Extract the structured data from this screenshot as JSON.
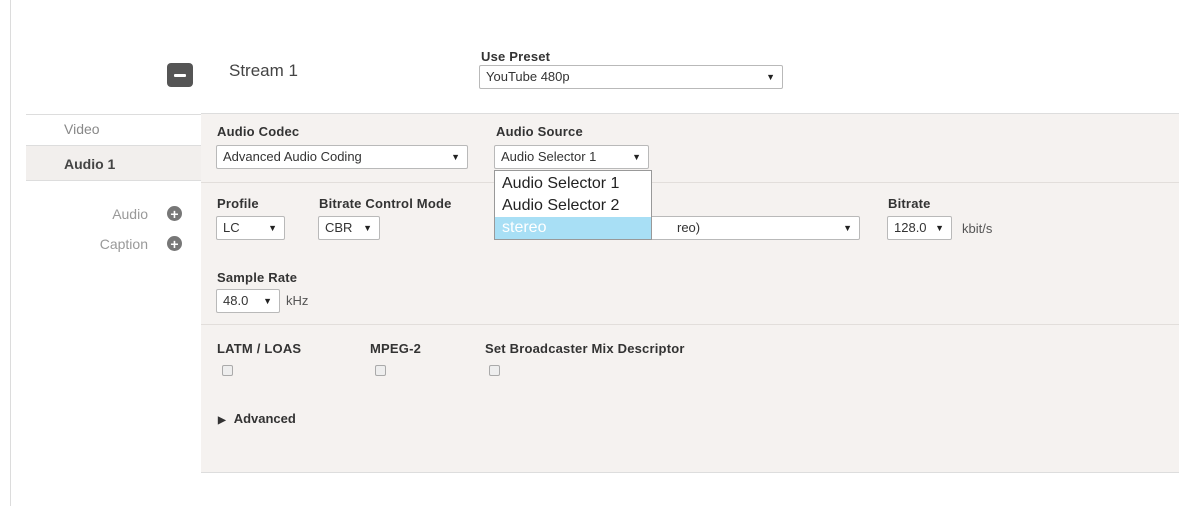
{
  "stream": {
    "title": "Stream 1",
    "preset_label": "Use Preset",
    "preset_value": "YouTube 480p"
  },
  "tabs": [
    {
      "label": "Video"
    },
    {
      "label": "Audio 1"
    }
  ],
  "add_actions": [
    {
      "label": "Audio",
      "icon": "plus-circle-icon"
    },
    {
      "label": "Caption",
      "icon": "plus-circle-icon"
    }
  ],
  "audio": {
    "codec_label": "Audio Codec",
    "codec_value": "Advanced Audio Coding",
    "source_label": "Audio Source",
    "source_value": "Audio Selector 1",
    "source_options": [
      "Audio Selector 1",
      "Audio Selector 2",
      "stereo"
    ],
    "source_highlighted": "stereo",
    "profile_label": "Profile",
    "profile_value": "LC",
    "bitrate_mode_label": "Bitrate Control Mode",
    "bitrate_mode_value": "CBR",
    "coding_mode_partial": "reo)",
    "bitrate_label": "Bitrate",
    "bitrate_value": "128.0",
    "bitrate_unit": "kbit/s",
    "sample_rate_label": "Sample Rate",
    "sample_rate_value": "48.0",
    "sample_rate_unit": "kHz",
    "latm_label": "LATM / LOAS",
    "mpeg2_label": "MPEG-2",
    "broadcaster_label": "Set Broadcaster Mix Descriptor",
    "advanced_label": "Advanced"
  },
  "colors": {
    "panel_bg": "#f5f2f0",
    "highlight": "#a8dff5",
    "button_dark": "#555555"
  }
}
